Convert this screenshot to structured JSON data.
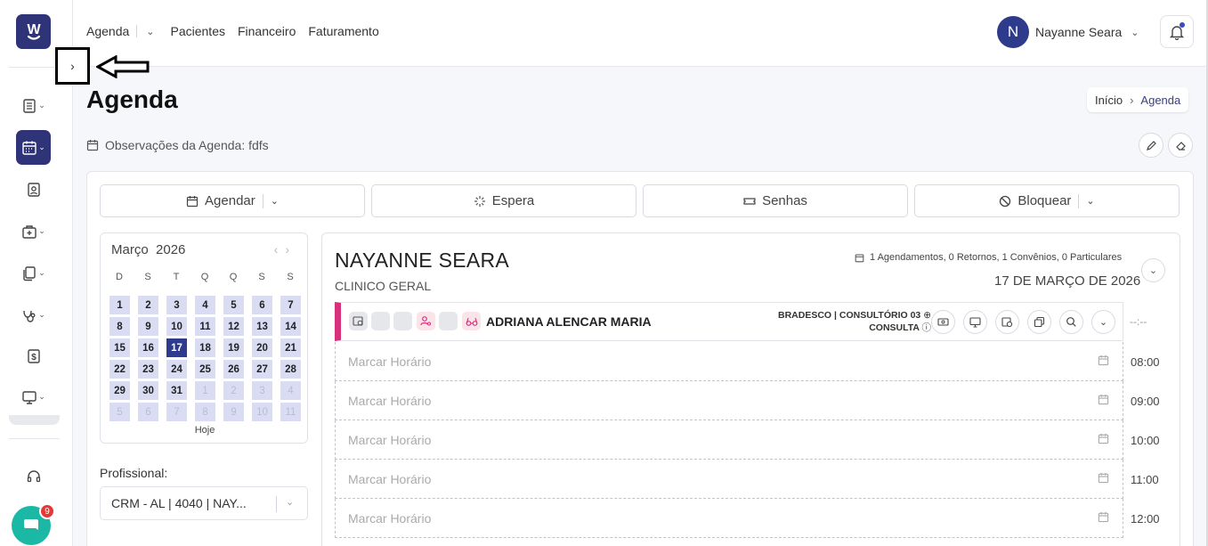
{
  "app": {
    "logo_text": "W"
  },
  "nav": {
    "agenda": "Agenda",
    "pacientes": "Pacientes",
    "financeiro": "Financeiro",
    "faturamento": "Faturamento"
  },
  "user": {
    "initial": "N",
    "name": "Nayanne Seara"
  },
  "page": {
    "title": "Agenda",
    "breadcrumb_home": "Início",
    "breadcrumb_current": "Agenda",
    "observacoes": "Observações da Agenda: fdfs"
  },
  "actions": {
    "agendar": "Agendar",
    "espera": "Espera",
    "senhas": "Senhas",
    "bloquear": "Bloquear"
  },
  "calendar": {
    "month_label": "Março  2026",
    "weekdays": [
      "D",
      "S",
      "T",
      "Q",
      "Q",
      "S",
      "S"
    ],
    "days": [
      [
        "1",
        "2",
        "3",
        "4",
        "5",
        "6",
        "7"
      ],
      [
        "8",
        "9",
        "10",
        "11",
        "12",
        "13",
        "14"
      ],
      [
        "15",
        "16",
        "17",
        "18",
        "19",
        "20",
        "21"
      ],
      [
        "22",
        "23",
        "24",
        "25",
        "26",
        "27",
        "28"
      ],
      [
        "29",
        "30",
        "31",
        "1",
        "2",
        "3",
        "4"
      ],
      [
        "5",
        "6",
        "7",
        "8",
        "9",
        "10",
        "11"
      ]
    ],
    "selected_day": "17",
    "today_label": "Hoje"
  },
  "professional": {
    "label": "Profissional:",
    "selected": "CRM - AL | 4040 | NAY..."
  },
  "schedule": {
    "doctor_name": "NAYANNE SEARA",
    "specialty": "CLINICO GERAL",
    "stats": "1 Agendamentos, 0 Retornos, 1 Convênios, 0 Particulares",
    "date": "17 DE MARÇO DE 2026",
    "appointment": {
      "patient": "ADRIANA ALENCAR MARIA",
      "insurance_room": "BRADESCO | CONSULTÓRIO 03",
      "type": "CONSULTA",
      "time": "--:--"
    },
    "slots": [
      {
        "label": "Marcar Horário",
        "time": "08:00"
      },
      {
        "label": "Marcar Horário",
        "time": "09:00"
      },
      {
        "label": "Marcar Horário",
        "time": "10:00"
      },
      {
        "label": "Marcar Horário",
        "time": "11:00"
      },
      {
        "label": "Marcar Horário",
        "time": "12:00"
      }
    ]
  },
  "chat": {
    "badge": "9"
  },
  "colors": {
    "primary": "#2e3477",
    "accent_pink": "#d8317c",
    "teal": "#1bb8a6"
  }
}
